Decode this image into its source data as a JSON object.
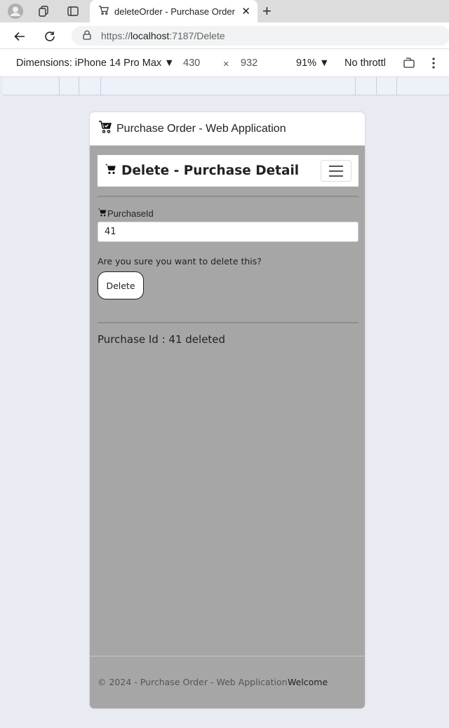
{
  "browser": {
    "tab_title": "deleteOrder - Purchase Order - W",
    "url_scheme": "https://",
    "url_host": "localhost",
    "url_rest": ":7187/Delete"
  },
  "devtools": {
    "dimensions_label": "Dimensions: iPhone 14 Pro Max",
    "width": "430",
    "times": "×",
    "height": "932",
    "zoom": "91%",
    "throttle": "No throttl"
  },
  "app": {
    "brand": "Purchase Order - Web Application",
    "page_title": "Delete - Purchase Detail",
    "field_label": "PurchaseId",
    "field_value": "41",
    "confirm_text": "Are you sure you want to delete this?",
    "delete_label": "Delete",
    "result_text": "Purchase Id : 41 deleted",
    "footer_text": "© 2024 - Purchase Order - Web Application -",
    "footer_link": "Welcome"
  }
}
